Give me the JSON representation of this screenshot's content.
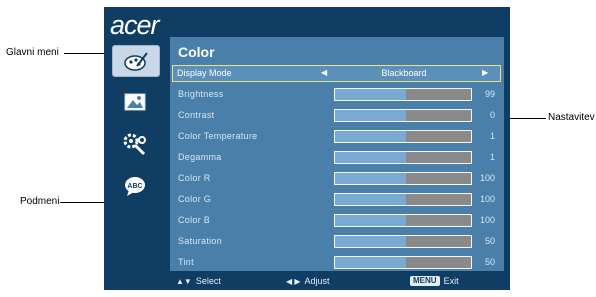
{
  "callouts": {
    "main_menu": "Glavni meni",
    "submenu": "Podmeni",
    "setting": "Nastavitev"
  },
  "osd": {
    "logo": "acer",
    "sidebar": [
      {
        "icon": "color-palette-icon",
        "active": true
      },
      {
        "icon": "picture-icon",
        "active": false
      },
      {
        "icon": "settings-wrench-icon",
        "active": false
      },
      {
        "icon": "language-abc-icon",
        "active": false
      }
    ],
    "menu_title": "Color",
    "display_mode": {
      "label": "Display Mode",
      "value": "Blackboard"
    },
    "items": [
      {
        "label": "Brightness",
        "value": "99",
        "fill": 0.52
      },
      {
        "label": "Contrast",
        "value": "0",
        "fill": 0.52
      },
      {
        "label": "Color Temperature",
        "value": "1",
        "fill": 0.52
      },
      {
        "label": "Degamma",
        "value": "1",
        "fill": 0.52
      },
      {
        "label": "Color R",
        "value": "100",
        "fill": 0.52
      },
      {
        "label": "Color G",
        "value": "100",
        "fill": 0.52
      },
      {
        "label": "Color B",
        "value": "100",
        "fill": 0.52
      },
      {
        "label": "Saturation",
        "value": "50",
        "fill": 0.52
      },
      {
        "label": "Tint",
        "value": "50",
        "fill": 0.52
      }
    ],
    "footer": {
      "select": "Select",
      "adjust": "Adjust",
      "menu_key": "MENU",
      "exit": "Exit"
    }
  },
  "colors": {
    "background": "#0f3d63",
    "panel": "#4a7fa9",
    "highlight_border": "#e7e28a",
    "slider_fill": "#7aa9d2",
    "slider_track": "#8a8a8a"
  }
}
